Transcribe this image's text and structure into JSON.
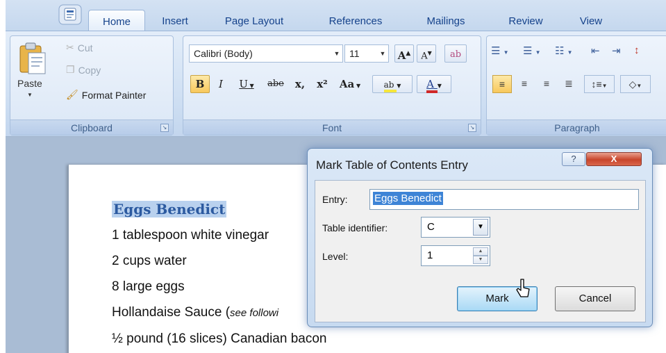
{
  "tabs": [
    "Home",
    "Insert",
    "Page Layout",
    "References",
    "Mailings",
    "Review",
    "View"
  ],
  "clipboard": {
    "paste_label": "Paste",
    "cut_label": "Cut",
    "copy_label": "Copy",
    "format_painter_label": "Format Painter",
    "group_label": "Clipboard"
  },
  "font": {
    "font_name": "Calibri (Body)",
    "font_size": "11",
    "group_label": "Font",
    "bold": "B",
    "italic": "I",
    "underline": "U",
    "strikethrough": "abe",
    "subscript": "x,",
    "superscript": "x²",
    "change_case": "Aa",
    "grow_font": "A",
    "shrink_font": "A",
    "highlight": "ab",
    "font_color": "A"
  },
  "paragraph": {
    "group_label": "Paragraph"
  },
  "document": {
    "heading": "Eggs Benedict",
    "lines": [
      "1 tablespoon white vinegar",
      "2 cups water",
      "8 large eggs",
      "Hollandaise Sauce (",
      "½ pound (16 slices) Canadian bacon"
    ],
    "hollandaise_note": "see followi"
  },
  "dialog": {
    "title": "Mark Table of Contents Entry",
    "help": "?",
    "close": "X",
    "entry_label": "Entry:",
    "entry_value": "Eggs Benedict",
    "table_identifier_label": "Table identifier:",
    "table_identifier_value": "C",
    "level_label": "Level:",
    "level_value": "1",
    "mark_button": "Mark",
    "cancel_button": "Cancel"
  },
  "colors": {
    "ribbon_text": "#15428b",
    "heading_text": "#2c5aa0",
    "heading_highlight": "#b9d1ee",
    "selection": "#3e84d6",
    "close_button": "#c8452c"
  }
}
